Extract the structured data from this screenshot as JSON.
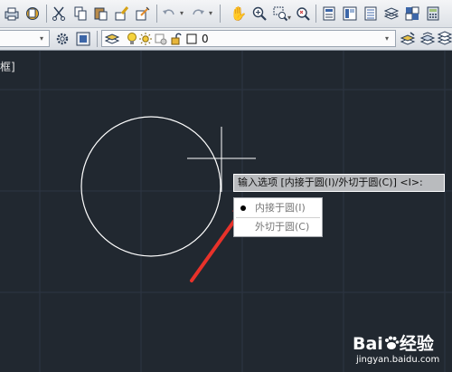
{
  "toolbar": {
    "row1_icons": [
      "plot-icon",
      "publish-icon",
      "cut-icon",
      "copy-icon",
      "paste-icon",
      "match-properties-icon",
      "undo-icon",
      "redo-icon",
      "pan-icon",
      "zoom-realtime-icon",
      "zoom-window-icon",
      "zoom-previous-icon",
      "properties-icon",
      "design-center-icon",
      "tool-palettes-icon",
      "sheet-set-icon",
      "markup-icon",
      "calculator-icon"
    ],
    "row2_icons": [
      "workspace-settings-icon",
      "lock-ui-icon",
      "layer-properties-icon",
      "bulb-on-icon",
      "sun-freeze-icon",
      "viewport-freeze-icon",
      "padlock-unlocked-icon",
      "layer-color-swatch-icon",
      "make-current-icon",
      "layer-previous-icon",
      "layer-states-icon"
    ],
    "layer_name": "0"
  },
  "canvas": {
    "viewport_label": "框]",
    "background_color": "#212830",
    "grid_color": "#2d3643"
  },
  "command": {
    "prompt_text": "输入选项 [内接于圆(I)/外切于圆(C)] <I>:",
    "options": [
      {
        "label": "内接于圆(I)",
        "selected": true
      },
      {
        "label": "外切于圆(C)",
        "selected": false
      }
    ]
  },
  "annotation": {
    "arrow_color": "#e8322a"
  },
  "watermark": {
    "brand": "Bai",
    "brand_suffix": "经验",
    "url": "jingyan.baidu.com"
  }
}
